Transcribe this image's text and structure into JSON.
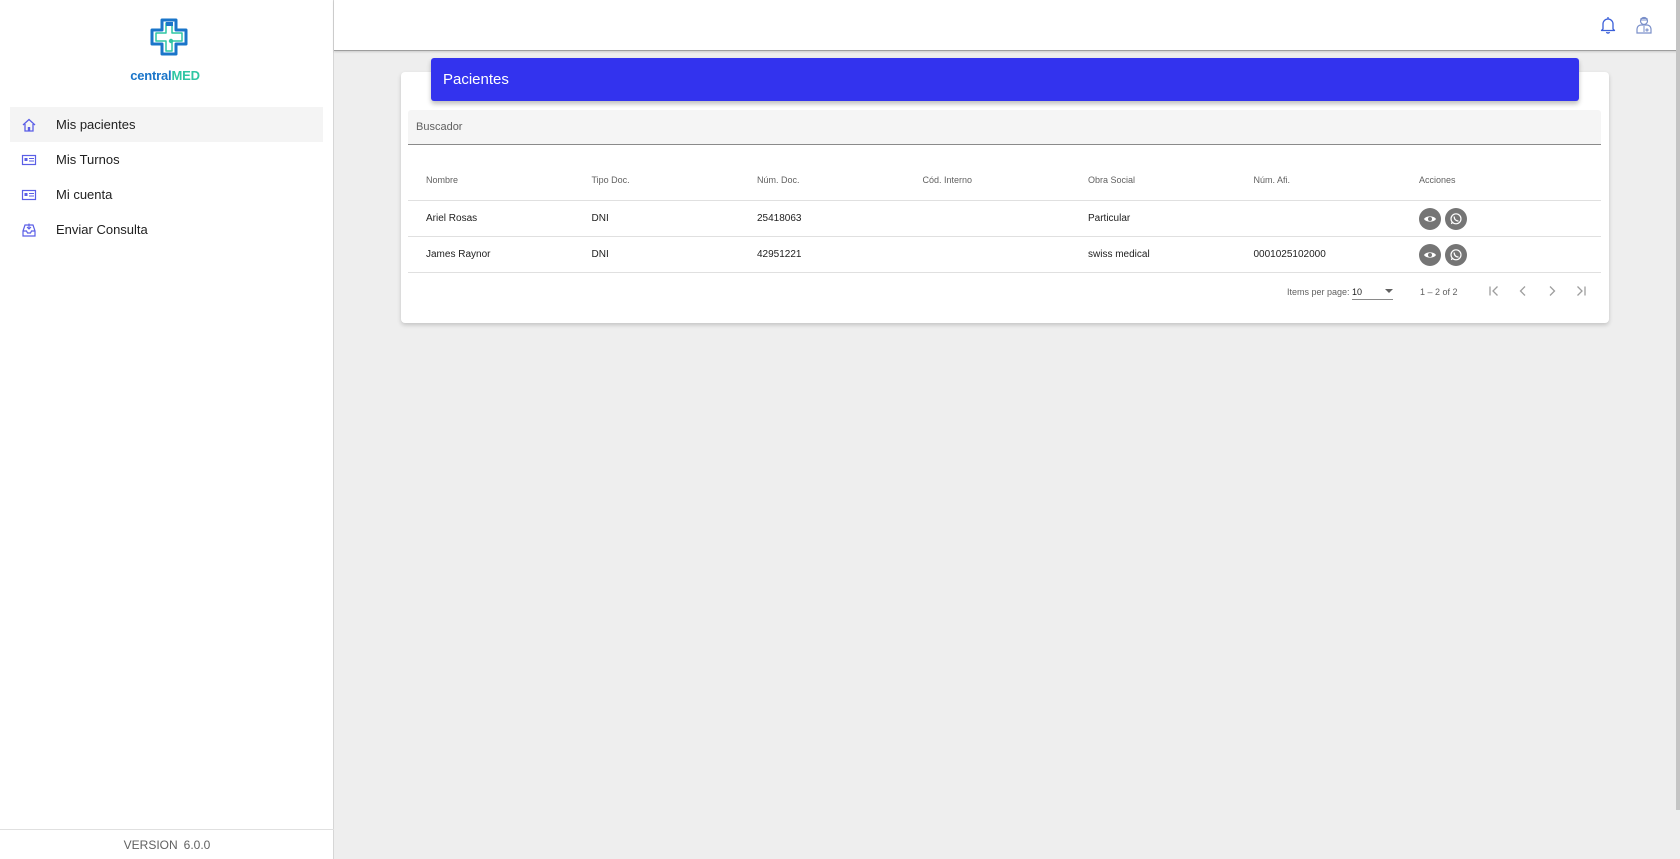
{
  "app": {
    "logo_part1": "central",
    "logo_part2": "MED"
  },
  "sidebar": {
    "items": [
      {
        "label": "Mis pacientes",
        "icon": "home-icon",
        "active": true
      },
      {
        "label": "Mis Turnos",
        "icon": "id-card-icon",
        "active": false
      },
      {
        "label": "Mi cuenta",
        "icon": "id-card-icon",
        "active": false
      },
      {
        "label": "Enviar Consulta",
        "icon": "send-inbox-icon",
        "active": false
      }
    ],
    "version_label": "VERSION",
    "version_number": "6.0.0"
  },
  "topbar": {
    "icons": [
      "bell-icon",
      "doctor-user-icon"
    ]
  },
  "card": {
    "title": "Pacientes",
    "search_placeholder": "Buscador"
  },
  "table": {
    "columns": [
      "Nombre",
      "Tipo Doc.",
      "Núm. Doc.",
      "Cód. Interno",
      "Obra Social",
      "Núm. Afi.",
      "Acciones"
    ],
    "rows": [
      [
        "Ariel Rosas",
        "DNI",
        "25418063",
        "",
        "Particular",
        ""
      ],
      [
        "James Raynor",
        "DNI",
        "42951221",
        "",
        "swiss medical",
        "0001025102000"
      ]
    ],
    "action_icons": [
      "eye-icon",
      "whatsapp-icon"
    ]
  },
  "paginator": {
    "items_per_page_label": "Items per page:",
    "items_per_page_value": "10",
    "range_label": "1 – 2 of 2"
  },
  "colors": {
    "header_bg": "#3333ee",
    "accent_blue": "#1a75c9",
    "accent_green": "#2fc6a3",
    "action_button": "#757575"
  }
}
